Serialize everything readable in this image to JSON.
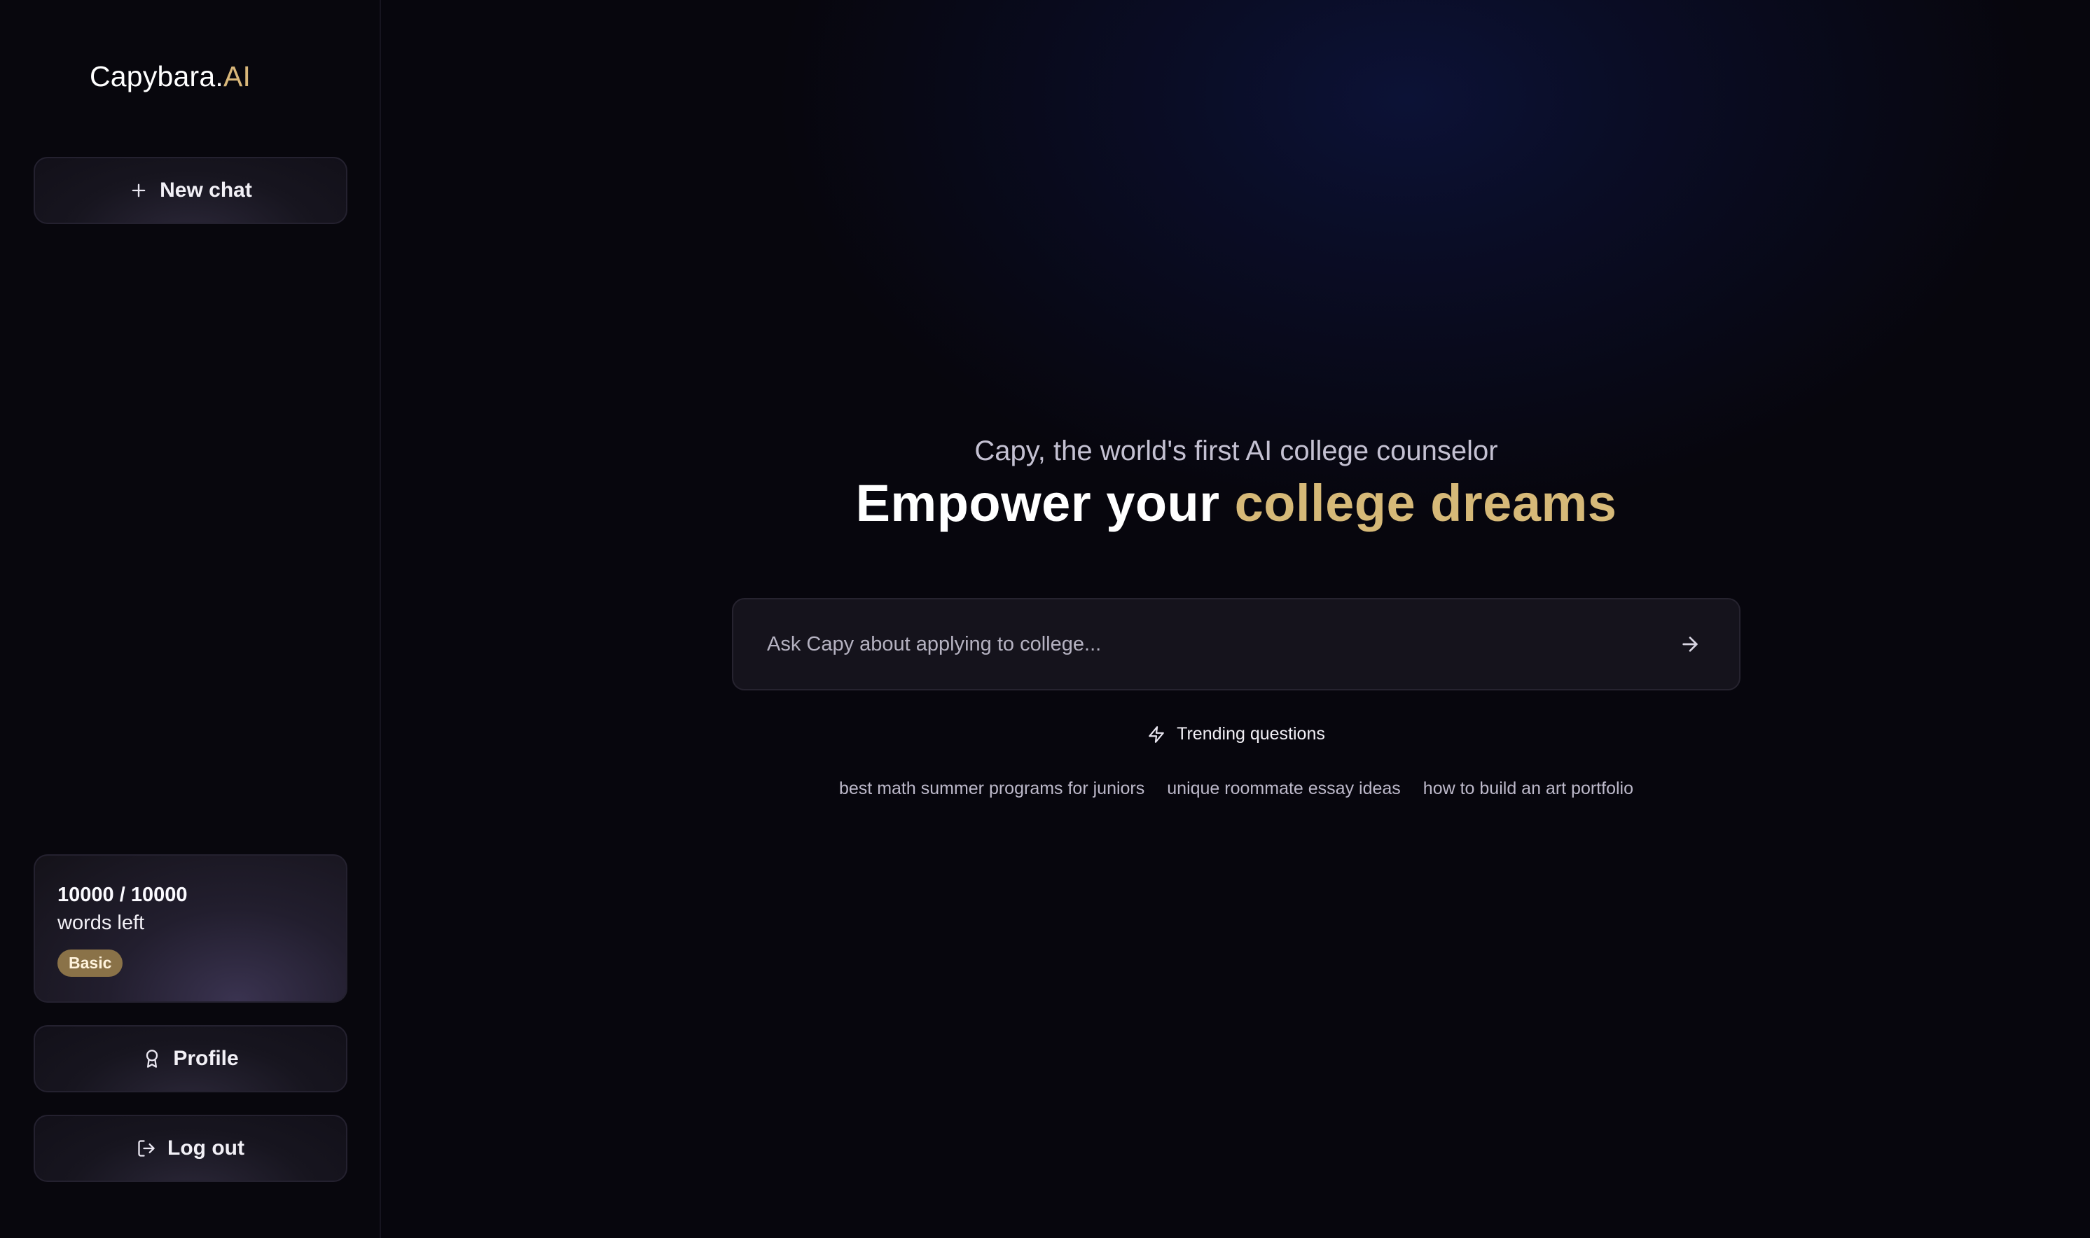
{
  "brand": {
    "name": "Capybara.",
    "accent": "AI"
  },
  "sidebar": {
    "new_chat_label": "New chat",
    "usage": {
      "count": "10000 / 10000",
      "label": "words left",
      "plan": "Basic"
    },
    "profile_label": "Profile",
    "logout_label": "Log out"
  },
  "hero": {
    "subtitle": "Capy, the world's first AI college counselor",
    "headline_plain": "Empower your ",
    "headline_highlight": "college dreams"
  },
  "search": {
    "placeholder": "Ask Capy about applying to college..."
  },
  "trending": {
    "label": "Trending questions",
    "questions": [
      "best math summer programs for juniors",
      "unique roommate essay ideas",
      "how to build an art portfolio"
    ]
  },
  "colors": {
    "accent_gold": "#d6b978",
    "background": "#07060d",
    "badge": "#8a7248"
  },
  "icons": {
    "new_chat": "plus-icon",
    "profile": "award-icon",
    "logout": "logout-icon",
    "send": "arrow-right-icon",
    "trending": "lightning-icon"
  }
}
